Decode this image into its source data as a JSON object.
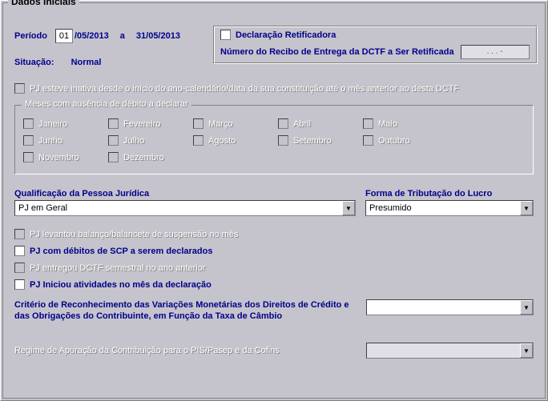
{
  "title": "Dados Iniciais",
  "period": {
    "label": "Período",
    "day": "01",
    "rest1": "/05/2013",
    "a": "a",
    "end": "31/05/2013"
  },
  "decl": {
    "check_label": "Declaração Retificadora",
    "recibo_label": "Número do Recibo de Entrega da DCTF a Ser Retificada",
    "recibo_value": ".    .    .   -"
  },
  "situacao": {
    "label": "Situação:",
    "value": "Normal"
  },
  "inativa_label": "PJ esteve inativa desde o início do ano-calendário/data da sua constituição até o mês anterior ao desta DCTF",
  "months": {
    "legend": "Meses com ausência de débito a declarar",
    "items": [
      "Janeiro",
      "Fevereiro",
      "Março",
      "Abril",
      "Maio",
      "Junho",
      "Julho",
      "Agosto",
      "Setembro",
      "Outubro",
      "Novembro",
      "Dezembro"
    ]
  },
  "qualificacao": {
    "label": "Qualificação da Pessoa Jurídica",
    "value": "PJ em Geral"
  },
  "tributacao": {
    "label": "Forma de Tributação do Lucro",
    "value": "Presumido"
  },
  "chk": {
    "balanco": "PJ levantou balanço/balancete de suspensão no mês",
    "scp": "PJ com débitos de SCP a serem declarados",
    "semestral": "PJ entregou DCTF semestral no ano anterior",
    "iniciou": "PJ Iniciou atividades no mês da declaração"
  },
  "criterio_label": "Critério de Reconhecimento das Variações Monetárias dos Direitos de Crédito e das Obrigações do Contribuinte, em Função da Taxa de Câmbio",
  "regime_label": "Regime de Apuração da Contribuição para o PIS/Pasep e da Cofins"
}
